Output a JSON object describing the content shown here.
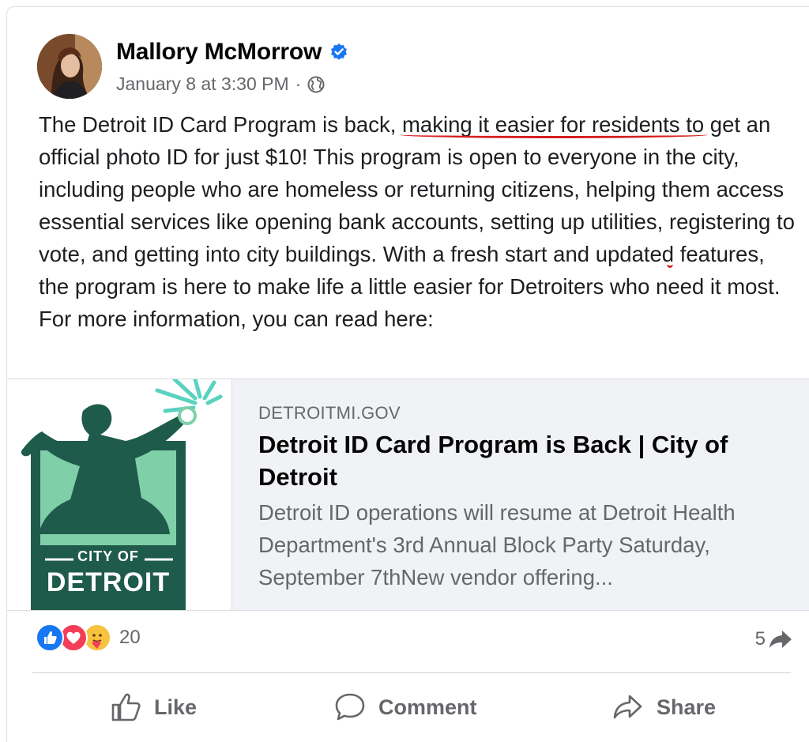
{
  "post": {
    "author": "Mallory McMorrow",
    "timestamp": "January 8 at 3:30 PM",
    "separator": "·",
    "text_parts": {
      "p1": "The Detroit ID Card Program is back, ",
      "p2": "making it easier for residents to",
      "p3": " get an official photo ID for just $10! This program is open to everyone in the city, including people who are homeless or returning citizens, helping them access essential services like opening bank accounts, setting up utilities, ",
      "p4": "registering to vote",
      "p5": ", and getting into city buildings. With a fresh start and updated features, the program is here to make life a little easier for Detroiters who need it most. For more information, you can read here:"
    }
  },
  "link_preview": {
    "domain": "DETROITMI.GOV",
    "title": "Detroit ID Card Program is Back | City of Detroit",
    "description": "Detroit ID operations will resume at Detroit Health Department's 3rd Annual Block Party Saturday, September 7thNew vendor offering...",
    "logo_text_top": "CITY OF",
    "logo_text_main": "DETROIT"
  },
  "engagement": {
    "reaction_count": "20",
    "share_count": "5",
    "reaction_icons": [
      "like-reaction-icon",
      "love-reaction-icon",
      "care-reaction-icon"
    ]
  },
  "actions": {
    "like_label": "Like",
    "comment_label": "Comment",
    "share_label": "Share"
  },
  "colors": {
    "accent": "#1877f2",
    "underline": "#d61f1f",
    "logo_green": "#1f5b4a",
    "logo_light": "#7fcfa9"
  }
}
